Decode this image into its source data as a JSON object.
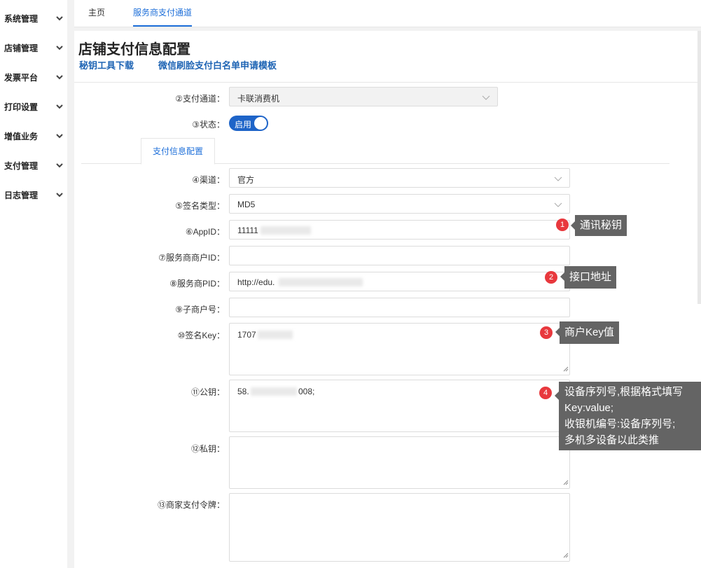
{
  "sidebar": {
    "items": [
      {
        "label": "系统管理"
      },
      {
        "label": "店铺管理"
      },
      {
        "label": "发票平台"
      },
      {
        "label": "打印设置"
      },
      {
        "label": "增值业务"
      },
      {
        "label": "支付管理"
      },
      {
        "label": "日志管理"
      }
    ]
  },
  "tabs": {
    "home": "主页",
    "active": "服务商支付通道"
  },
  "page": {
    "title": "店铺支付信息配置",
    "link_key_tool": "秘钥工具下载",
    "link_wechat_template": "微信刷脸支付白名单申请模板"
  },
  "form": {
    "pay_channel": {
      "label": "②支付通道：",
      "value": "卡联消费机"
    },
    "status": {
      "label": "③状态：",
      "value": "启用"
    },
    "subtab": "支付信息配置",
    "channel": {
      "label": "④渠道：",
      "value": "官方"
    },
    "sign_type": {
      "label": "⑤签名类型：",
      "value": "MD5"
    },
    "app_id": {
      "label": "⑥AppID：",
      "value": "11111"
    },
    "sp_merchant_id": {
      "label": "⑦服务商商户ID：",
      "value": ""
    },
    "sp_pid": {
      "label": "⑧服务商PID：",
      "value": "http://edu."
    },
    "sub_merchant": {
      "label": "⑨子商户号：",
      "value": ""
    },
    "sign_key": {
      "label": "⑩签名Key：",
      "value": "1707"
    },
    "public_key": {
      "label": "⑪公钥：",
      "value_prefix": "58.",
      "value_suffix": "008;"
    },
    "private_key": {
      "label": "⑫私钥：",
      "value": ""
    },
    "merchant_token": {
      "label": "⑬商家支付令牌：",
      "value": ""
    }
  },
  "callouts": [
    {
      "num": "1",
      "text": "通讯秘钥"
    },
    {
      "num": "2",
      "text": "接口地址"
    },
    {
      "num": "3",
      "text": "商户Key值"
    },
    {
      "num": "4",
      "lines": [
        "设备序列号,根据格式填写",
        "Key:value;",
        "收银机编号:设备序列号;",
        "多机多设备以此类推"
      ]
    }
  ],
  "colors": {
    "accent": "#1e6fd9",
    "link": "#1e64b4",
    "toggle": "#1e64c8",
    "badge": "#e8383d",
    "tooltip": "#646464"
  },
  "icons": {
    "dropdown": "chevron-down-icon",
    "sidebar_expand": "chevron-down-icon",
    "resize": "resize-handle-icon"
  }
}
